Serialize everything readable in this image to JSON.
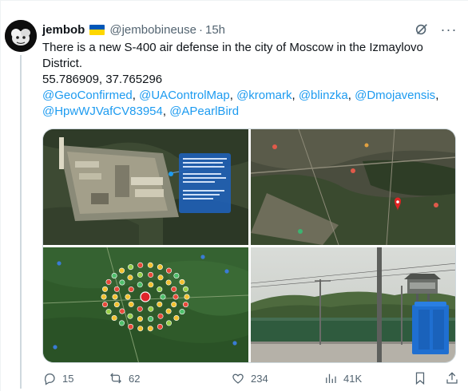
{
  "author": {
    "name": "jembob",
    "handle": "@jembobineuse",
    "time": "15h",
    "flag_icon": "ukraine-flag-icon"
  },
  "tweet": {
    "line1": "There is a new S-400 air defense in the city of Moscow in the Izmaylovo",
    "line2": "District.",
    "coords": "55.786909, 37.765296",
    "mentions": [
      "@GeoConfirmed",
      "@UAControlMap",
      "@kromark",
      "@blinzka",
      "@Dmojavensis",
      "@HpwWJVafCV83954",
      "@APearlBird"
    ]
  },
  "media": {
    "count": 4,
    "items": [
      "satellite-closeup-image",
      "satellite-map-image",
      "map-markers-image",
      "street-photo-image"
    ]
  },
  "stats": {
    "replies": "15",
    "reposts": "62",
    "likes": "234",
    "views": "41K"
  },
  "colors": {
    "link": "#1d9bf0",
    "secondary_text": "#536471",
    "primary_text": "#0f1419",
    "flag_blue": "#0057b7",
    "flag_yellow": "#ffd700"
  }
}
